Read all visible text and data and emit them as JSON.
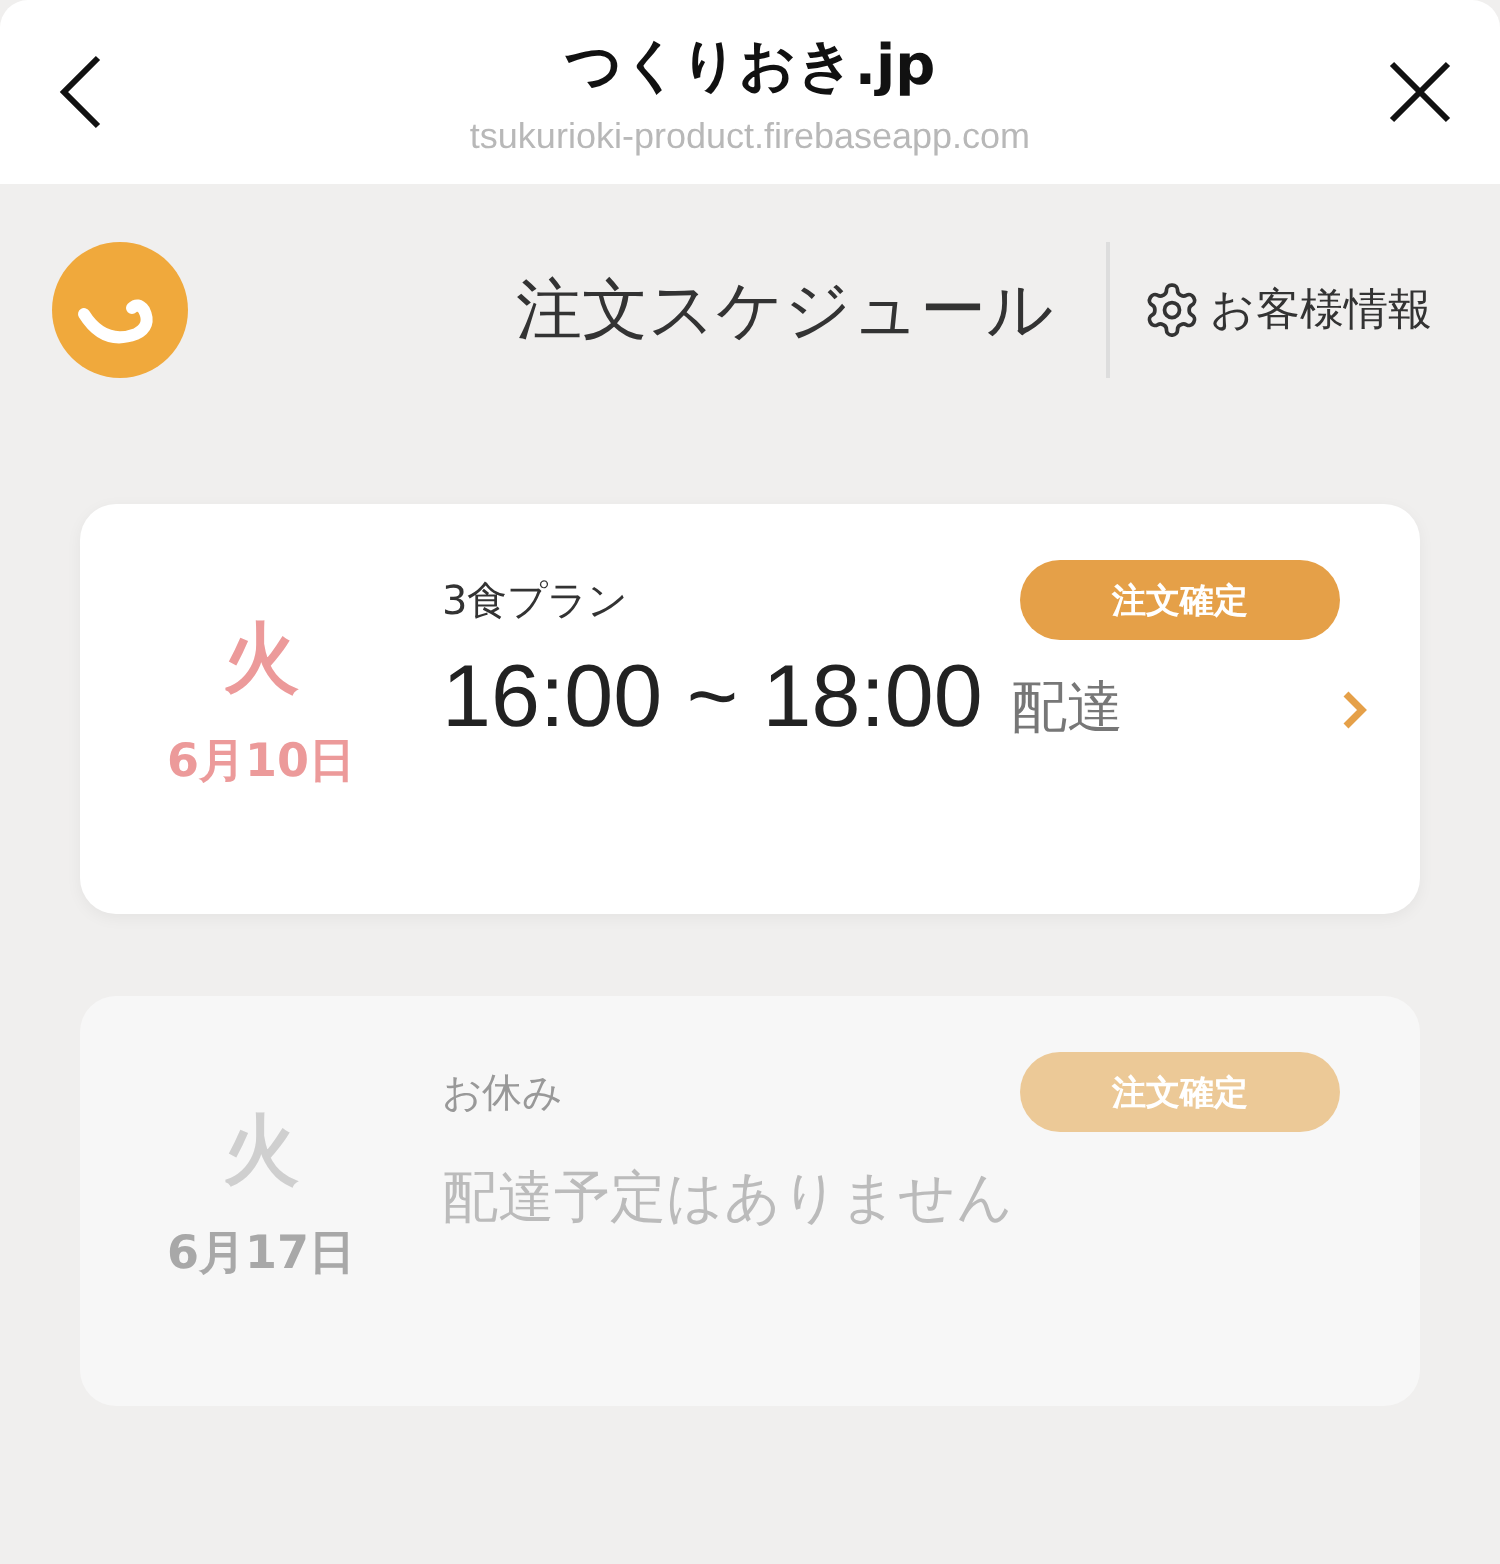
{
  "browser_bar": {
    "title": "つくりおき.jp",
    "url": "tsukurioki-product.firebaseapp.com"
  },
  "header": {
    "title": "注文スケジュール",
    "account_link": "お客様情報"
  },
  "schedule": [
    {
      "kind": "delivery",
      "disabled": false,
      "weekday": "火",
      "date": "6月10日",
      "plan": "3食プラン",
      "status": "注文確定",
      "time": "16:00 ~ 18:00",
      "suffix": "配達"
    },
    {
      "kind": "off",
      "disabled": true,
      "weekday": "火",
      "date": "6月17日",
      "plan": "お休み",
      "status": "注文確定",
      "message": "配達予定はありません"
    }
  ]
}
